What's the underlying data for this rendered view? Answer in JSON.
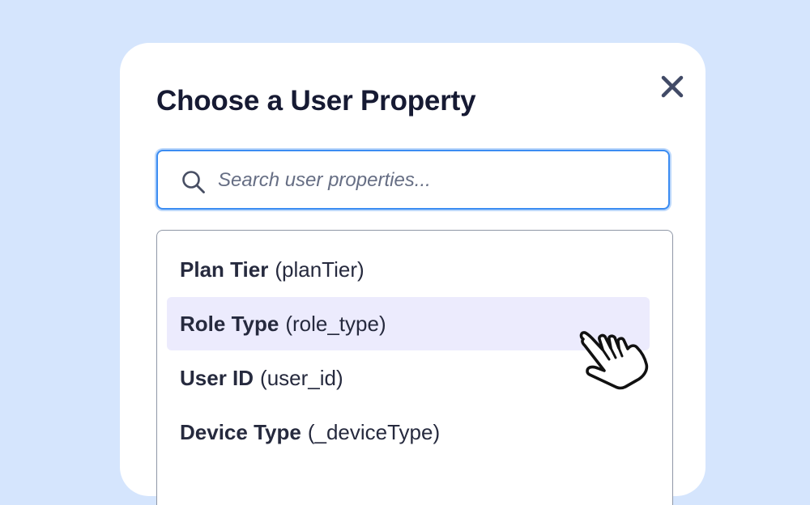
{
  "modal": {
    "title": "Choose a User Property",
    "close_icon": "close-icon"
  },
  "search": {
    "placeholder": "Search user properties...",
    "value": "",
    "icon": "search-icon"
  },
  "properties": [
    {
      "name": "Plan Tier",
      "key": "(planTier)",
      "highlighted": false
    },
    {
      "name": "Role Type",
      "key": "(role_type)",
      "highlighted": true
    },
    {
      "name": "User ID",
      "key": "(user_id)",
      "highlighted": false
    },
    {
      "name": "Device Type",
      "key": "(_deviceType)",
      "highlighted": false
    }
  ],
  "cursor": {
    "icon": "hand-pointer-icon"
  },
  "colors": {
    "page_background": "#d5e5fd",
    "modal_background": "#ffffff",
    "title_text": "#161a33",
    "close_icon": "#414a66",
    "focus_border": "#3b8cf2",
    "highlight_row": "#ecebfd",
    "list_border": "#8f97a6"
  }
}
